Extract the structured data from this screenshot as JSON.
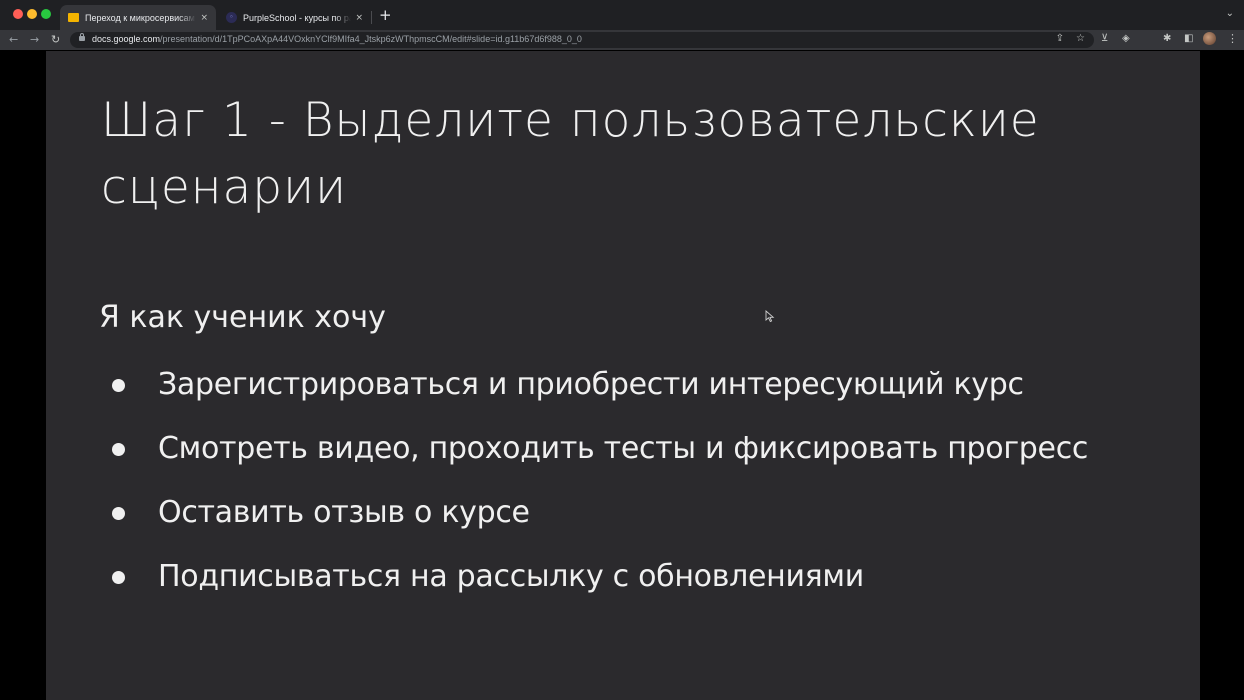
{
  "browser": {
    "tabs": [
      {
        "title": "Переход к микросервисам - ",
        "active": true
      },
      {
        "title": "PurpleSchool - курсы по разработке",
        "active": false
      }
    ],
    "tab_close_glyph": "×",
    "new_tab_glyph": "+",
    "url_host": "docs.google.com",
    "url_path": "/presentation/d/1TpPCoAXpA44VOxknYClf9MIfa4_Jtskp6zWThpmscCM/edit#slide=id.g11b67d6f988_0_0"
  },
  "icons": {
    "back": "back-arrow-icon",
    "forward": "forward-arrow-icon",
    "reload": "reload-icon",
    "lock": "lock-icon",
    "share": "share-icon",
    "bookmark": "star-icon",
    "extensions": "puzzle-icon",
    "menu": "kebab-menu-icon"
  },
  "slide": {
    "title": "Шаг 1 - Выделите пользовательские сценарии",
    "intro": "Я как ученик хочу",
    "bullets": [
      "Зарегистрироваться и приобрести интересующий курс",
      "Смотреть видео, проходить тесты и фиксировать прогресс",
      "Оставить отзыв о курсе",
      "Подписываться на рассылку с обновлениями"
    ],
    "background_color": "#2b2a2d",
    "text_color": "#f0f0f0"
  }
}
